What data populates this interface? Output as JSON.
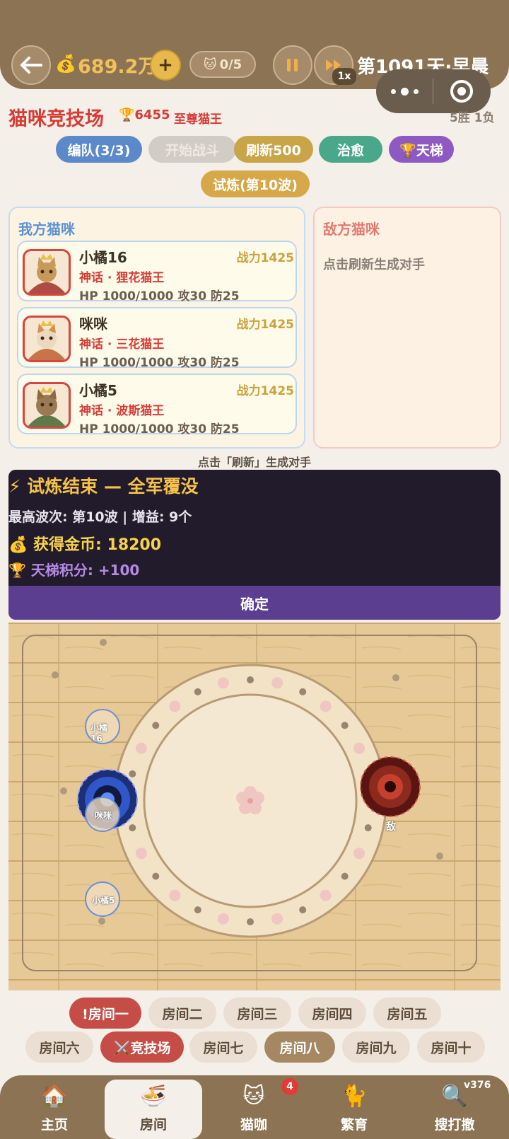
{
  "header": {
    "coins": "689.2万",
    "add_label": "+",
    "cat_count": "0/5",
    "speed": "1x",
    "day": "第1091天·早晨"
  },
  "arena": {
    "title": "猫咪竞技场",
    "trophy_score": "🏆6455",
    "rank": "至尊猫王",
    "record": "5胜 1负"
  },
  "actions": {
    "formation": "编队(3/3)",
    "start": "开始战斗",
    "refresh": "刷新500",
    "heal": "治愈",
    "ladder": "🏆天梯",
    "trial": "试炼(第10波)"
  },
  "my_team": {
    "title": "我方猫咪",
    "cats": [
      {
        "name": "小橘16",
        "power": "战力1425",
        "rarity": "神话 · 狸花猫王",
        "stats": "HP 1000/1000  攻30 防25",
        "coat": "#c89a5a"
      },
      {
        "name": "咪咪",
        "power": "战力1425",
        "rarity": "神话 · 三花猫王",
        "stats": "HP 1000/1000  攻30 防25",
        "coat": "#e8d0b0"
      },
      {
        "name": "小橘5",
        "power": "战力1425",
        "rarity": "神话 · 波斯猫王",
        "stats": "HP 1000/1000  攻30 防25",
        "coat": "#9a7a52"
      }
    ]
  },
  "enemy_team": {
    "title": "敌方猫咪",
    "hint": "点击刷新生成对手"
  },
  "refresh_hint": "点击「刷新」生成对手",
  "result": {
    "title": "⚡ 试炼结束 — 全军覆没",
    "wave": "最高波次: 第10波 | 增益: 9个",
    "gold": "💰 获得金币: 18200",
    "ladder": "🏆 天梯积分: +100",
    "confirm": "确定"
  },
  "battlefield": {
    "units": [
      {
        "label": "小橘16"
      },
      {
        "label": "咪咪"
      },
      {
        "label": "小橘5"
      }
    ],
    "enemy_label": "敌"
  },
  "rooms": {
    "row1": [
      "!房间一",
      "房间二",
      "房间三",
      "房间四",
      "房间五"
    ],
    "row2": [
      "房间六",
      "⚔️竞技场",
      "房间七",
      "房间八",
      "房间九",
      "房间十"
    ]
  },
  "nav": {
    "home": "主页",
    "room": "房间",
    "cafe": "猫咖",
    "cafe_badge": "4",
    "breed": "繁育",
    "search": "搜打撤",
    "version": "v376"
  },
  "colors": {
    "header_bg": "#8b7354",
    "accent_red": "#d63c36",
    "gold": "#f0c15a",
    "result_bg": "#211b2b",
    "confirm_bg": "#5c3e91"
  }
}
